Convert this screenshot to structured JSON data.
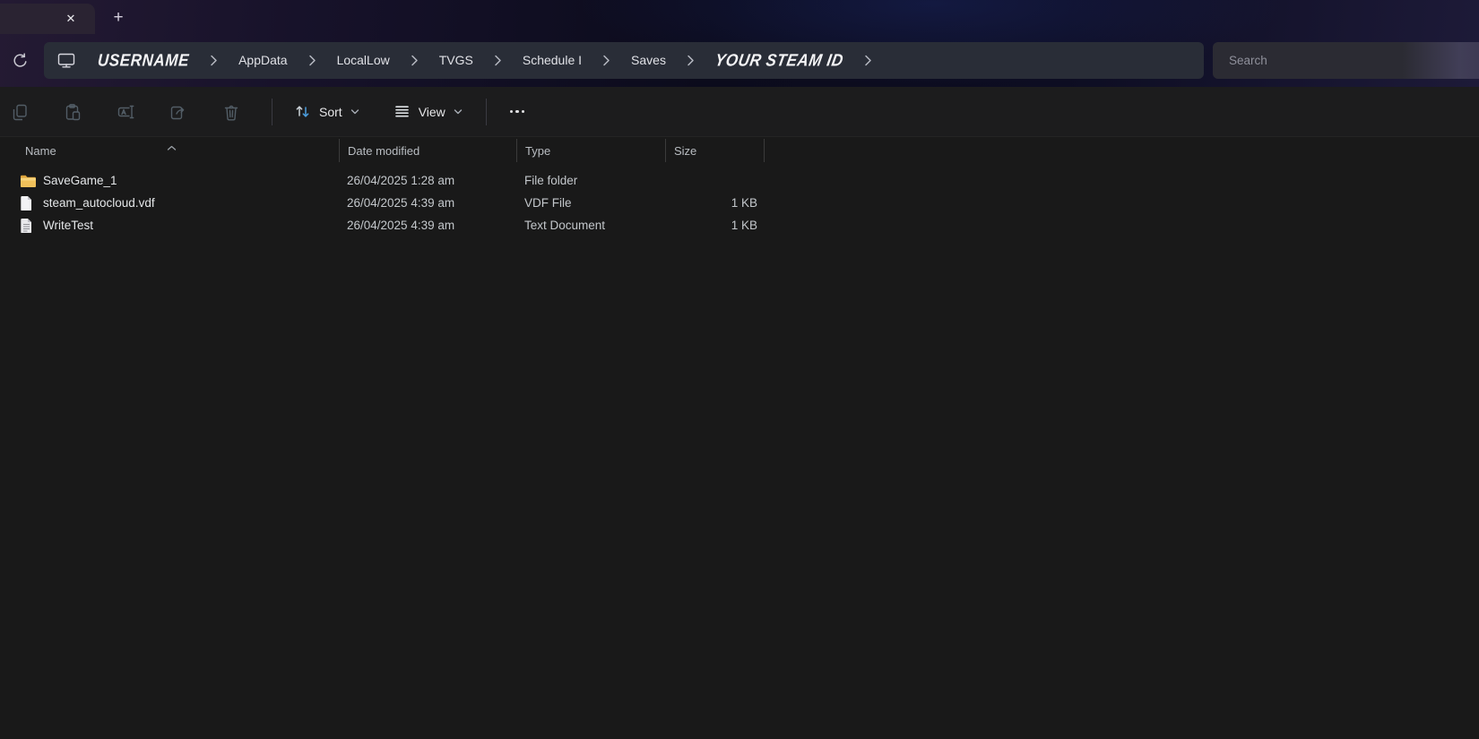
{
  "tab_bar": {
    "close_label": "✕",
    "new_tab_label": "+"
  },
  "address": {
    "breadcrumbs": [
      "USERNAME",
      "AppData",
      "LocalLow",
      "TVGS",
      "Schedule I",
      "Saves",
      "YOUR STEAM ID"
    ]
  },
  "search": {
    "placeholder": "Search"
  },
  "toolbar": {
    "sort_label": "Sort",
    "view_label": "View",
    "icon_names": [
      "copy-icon",
      "paste-icon",
      "rename-icon",
      "share-icon",
      "delete-icon",
      "sort-arrows-icon",
      "view-lines-icon",
      "more-options-icon"
    ]
  },
  "columns": {
    "name": "Name",
    "date": "Date modified",
    "type": "Type",
    "size": "Size"
  },
  "files": [
    {
      "name": "SaveGame_1",
      "icon": "folder-icon",
      "date": "26/04/2025 1:28 am",
      "type": "File folder",
      "size": ""
    },
    {
      "name": "steam_autocloud.vdf",
      "icon": "file-icon",
      "date": "26/04/2025 4:39 am",
      "type": "VDF File",
      "size": "1 KB"
    },
    {
      "name": "WriteTest",
      "icon": "text-document-icon",
      "date": "26/04/2025 4:39 am",
      "type": "Text Document",
      "size": "1 KB"
    }
  ],
  "colors": {
    "chrome_purple_left": "#241a33",
    "chrome_navy": "#0b0b1c",
    "chrome_purple_right": "#3a3750",
    "tab_bg": "#2a2332",
    "addressbar_bg": "#292d37",
    "toolbar_bg": "#1c1c1d",
    "content_bg": "#191919",
    "folder_yellow": "#f0c05a",
    "sort_arrow_blue": "#4c9fe0",
    "disabled_icon": "#525d66",
    "text_primary": "#e4e6e8",
    "text_secondary": "#c3c7cb"
  }
}
